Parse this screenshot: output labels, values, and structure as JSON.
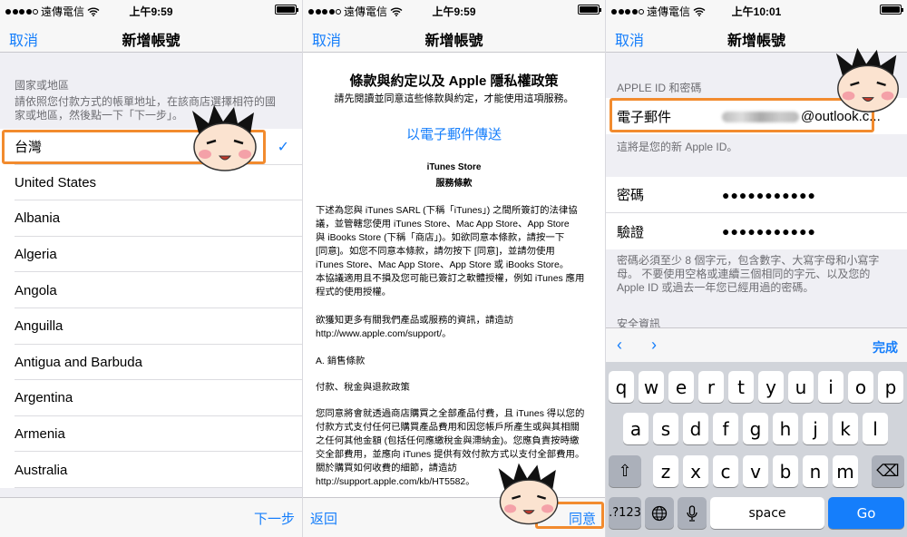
{
  "status": {
    "carrier": "遠傳電信",
    "times": [
      "上午9:59",
      "上午9:59",
      "上午10:01"
    ]
  },
  "panel1": {
    "nav": {
      "cancel": "取消",
      "title": "新增帳號"
    },
    "section_header": "國家或地區",
    "section_note_line1": "請依照您付款方式的帳單地址，在該商店選擇相符的國",
    "section_note_line2": "家或地區，然後點一下「下一步」。",
    "countries": [
      "台灣",
      "United States",
      "Albania",
      "Algeria",
      "Angola",
      "Anguilla",
      "Antigua and Barbuda",
      "Argentina",
      "Armenia",
      "Australia"
    ],
    "selected_check": "✓",
    "next": "下一步"
  },
  "panel2": {
    "nav": {
      "cancel": "取消",
      "title": "新增帳號"
    },
    "terms_title": "條款與約定以及 Apple 隱私權政策",
    "terms_sub": "請先閱讀並同意這些條款與約定，才能使用這項服務。",
    "email_link": "以電子郵件傳送",
    "store_name": "iTunes Store",
    "store_terms": "服務條款",
    "para1": [
      "下述為您與 iTunes SARL (下稱「iTunes」) 之間所簽訂的法律協",
      "議，並管轄您使用 iTunes Store、Mac App Store、App Store",
      "與 iBooks Store (下稱「商店」)。如欲同意本條款，請按一下",
      "[同意]。如您不同意本條款，請勿按下 [同意]，並請勿使用",
      "iTunes Store、Mac App Store、App Store 或 iBooks Store。",
      "本協議適用且不損及您可能已簽訂之軟體授權，例如 iTunes 應用",
      "程式的使用授權。"
    ],
    "para2": [
      "欲獲知更多有關我們產品或服務的資訊，請造訪",
      "http://www.apple.com/support/。"
    ],
    "para3": "A. 銷售條款",
    "para4": "付款、稅金與退款政策",
    "para5": [
      "您同意將會就透過商店購買之全部產品付費，且 iTunes 得以您的",
      "付款方式支付任何已購買產品費用和因您帳戶所產生或與其相關",
      "之任何其他金額 (包括任何應繳稅金與滯納金)。您應負責按時繳",
      "交全部費用，並應向 iTunes 提供有效付款方式以支付全部費用。",
      "關於購買如何收費的細節，請造訪",
      "http://support.apple.com/kb/HT5582。"
    ],
    "back": "返回",
    "agree": "同意"
  },
  "panel3": {
    "nav": {
      "cancel": "取消",
      "title": "新增帳號"
    },
    "group_header": "APPLE ID 和密碼",
    "email_label": "電子郵件",
    "email_value": "@outlook.c...",
    "email_note": "這將是您的新 Apple ID。",
    "password_label": "密碼",
    "password_value": "●●●●●●●●●●●",
    "verify_label": "驗證",
    "verify_value": "●●●●●●●●●●●",
    "pw_note1": "密碼必須至少 8 個字元，包含數字、大寫字母和小寫字",
    "pw_note2": "母。 不要使用空格或連續三個相同的字元、以及您的",
    "pw_note3": "Apple ID 或過去一年您已經用過的密碼。",
    "security_header": "安全資訊",
    "keyboard": {
      "prev": "‹",
      "next": "›",
      "done": "完成",
      "row1": [
        "q",
        "w",
        "e",
        "r",
        "t",
        "y",
        "u",
        "i",
        "o",
        "p"
      ],
      "row2": [
        "a",
        "s",
        "d",
        "f",
        "g",
        "h",
        "j",
        "k",
        "l"
      ],
      "row3": [
        "z",
        "x",
        "c",
        "v",
        "b",
        "n",
        "m"
      ],
      "shift": "⇧",
      "delete": "⌫",
      "numbers": ".?123",
      "globe": "🌐",
      "mic": "🎤",
      "space": "space",
      "go": "Go"
    }
  },
  "colors": {
    "ios_blue": "#157efb",
    "highlight_orange": "#f28b2e"
  },
  "icons": [
    "wifi-icon",
    "battery-icon",
    "checkmark-icon",
    "cartoon-face-icon",
    "chevron-left-icon",
    "chevron-right-icon",
    "shift-icon",
    "delete-icon",
    "globe-icon",
    "microphone-icon"
  ]
}
